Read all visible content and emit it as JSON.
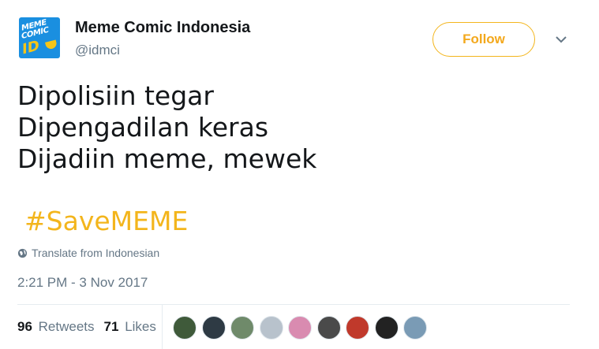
{
  "account": {
    "name": "Meme Comic Indonesia",
    "handle": "@idmci",
    "logo_lines": [
      "MEME",
      "COMIC",
      "ID"
    ]
  },
  "follow_label": "Follow",
  "tweet": {
    "lines": [
      "Dipolisiin tegar",
      "Dipengadilan keras",
      "Dijadiin meme, mewek"
    ],
    "hashtag": "#SaveMEME",
    "translate": "Translate from Indonesian",
    "timestamp": "2:21 PM - 3 Nov 2017"
  },
  "stats": {
    "retweets_count": "96",
    "retweets_label": "Retweets",
    "likes_count": "71",
    "likes_label": "Likes"
  },
  "likers": [
    {
      "name": "liker-1",
      "color": "#3f5a3a"
    },
    {
      "name": "liker-2",
      "color": "#2e3a44"
    },
    {
      "name": "liker-3",
      "color": "#6f8a6a"
    },
    {
      "name": "liker-4",
      "color": "#b8c2cc"
    },
    {
      "name": "liker-5",
      "color": "#d98bb0"
    },
    {
      "name": "liker-6",
      "color": "#4a4a4a"
    },
    {
      "name": "liker-7",
      "color": "#c0392b"
    },
    {
      "name": "liker-8",
      "color": "#222222"
    },
    {
      "name": "liker-9",
      "color": "#7a9bb5"
    }
  ],
  "colors": {
    "accent": "#f3b51c",
    "muted": "#657786",
    "text": "#14171a"
  },
  "icons": {
    "globe": "globe-icon",
    "chevron": "chevron-down-icon"
  }
}
